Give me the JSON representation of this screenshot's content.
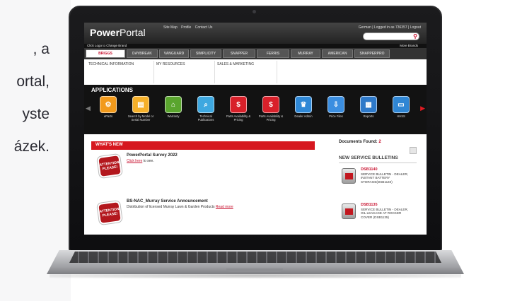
{
  "background": {
    "lines": [
      ", a",
      "ortal,",
      "yste",
      "ázek."
    ]
  },
  "header": {
    "logo_prefix": "Power",
    "logo_suffix": "Portal",
    "links": [
      "Site Map",
      "Profile",
      "Contact Us"
    ],
    "user_text": "German | Logged in as 736357 | Logout"
  },
  "brand_bar": {
    "label": "Click Logo to Change Brand",
    "more": "More Brands",
    "brands": [
      "BRIGGS",
      "DAYBREAK",
      "VANGUARD",
      "SIMPLICITY",
      "SNAPPER",
      "FERRIS",
      "MURRAY",
      "AMERICAN",
      "SNAPPERPRO"
    ]
  },
  "nav": {
    "items": [
      "TECHNICAL INFORMATION",
      "MY RESOURCES",
      "SALES & MARKETING"
    ]
  },
  "applications": {
    "title": "APPLICATIONS",
    "items": [
      {
        "label": "eParts",
        "icon": "gear-icon",
        "color": "#f29a1c",
        "glyph": "⚙"
      },
      {
        "label": "Search by Model or Serial Number",
        "icon": "search-doc-icon",
        "color": "#f5b02a",
        "glyph": "▤"
      },
      {
        "label": "Warranty",
        "icon": "warranty-icon",
        "color": "#5aa52e",
        "glyph": "⌂"
      },
      {
        "label": "Technical Publications",
        "icon": "magnifier-icon",
        "color": "#3ea8e0",
        "glyph": "⌕"
      },
      {
        "label": "Parts Availability & Pricing",
        "icon": "price-tag-icon",
        "color": "#d8202a",
        "glyph": "$"
      },
      {
        "label": "Parts Availability & Pricing",
        "icon": "price-tag-icon",
        "color": "#d8202a",
        "glyph": "$"
      },
      {
        "label": "Dealer Admin",
        "icon": "admin-icon",
        "color": "#2f88d6",
        "glyph": "♛"
      },
      {
        "label": "Price Files",
        "icon": "price-file-icon",
        "color": "#3b8ee0",
        "glyph": "⇩"
      },
      {
        "label": "Reports",
        "icon": "reports-icon",
        "color": "#2e79c9",
        "glyph": "▦"
      },
      {
        "label": "HHSS",
        "icon": "hhss-icon",
        "color": "#2f86d4",
        "glyph": "▭"
      }
    ]
  },
  "news": {
    "title": "WHAT'S NEW",
    "items": [
      {
        "title": "PowerPortal Survey 2022",
        "link": "Click here",
        "text": " to see.",
        "badge": "ATTENTION PLEASE!"
      },
      {
        "title": "BS-NAC_Murray Service Announcement",
        "text": "Distribution of licensed Murray Lawn & Garden Products ",
        "link": "Read more",
        "badge": "ATTENTION PLEASE!"
      }
    ]
  },
  "documents": {
    "label": "Documents Found:",
    "count": "2",
    "section_title": "NEW SERVICE BULLETINS",
    "bulletins": [
      {
        "id": "DSB1140",
        "text": "SERVICE BULLETIN - DEALER, INSTANT BATTERY STORAGE(DSB1140)"
      },
      {
        "id": "DSB1135",
        "text": "SERVICE BULLETIN - DEALER, OIL LEAKAGE AT ROCKER COVER (DSB1135)"
      }
    ]
  }
}
